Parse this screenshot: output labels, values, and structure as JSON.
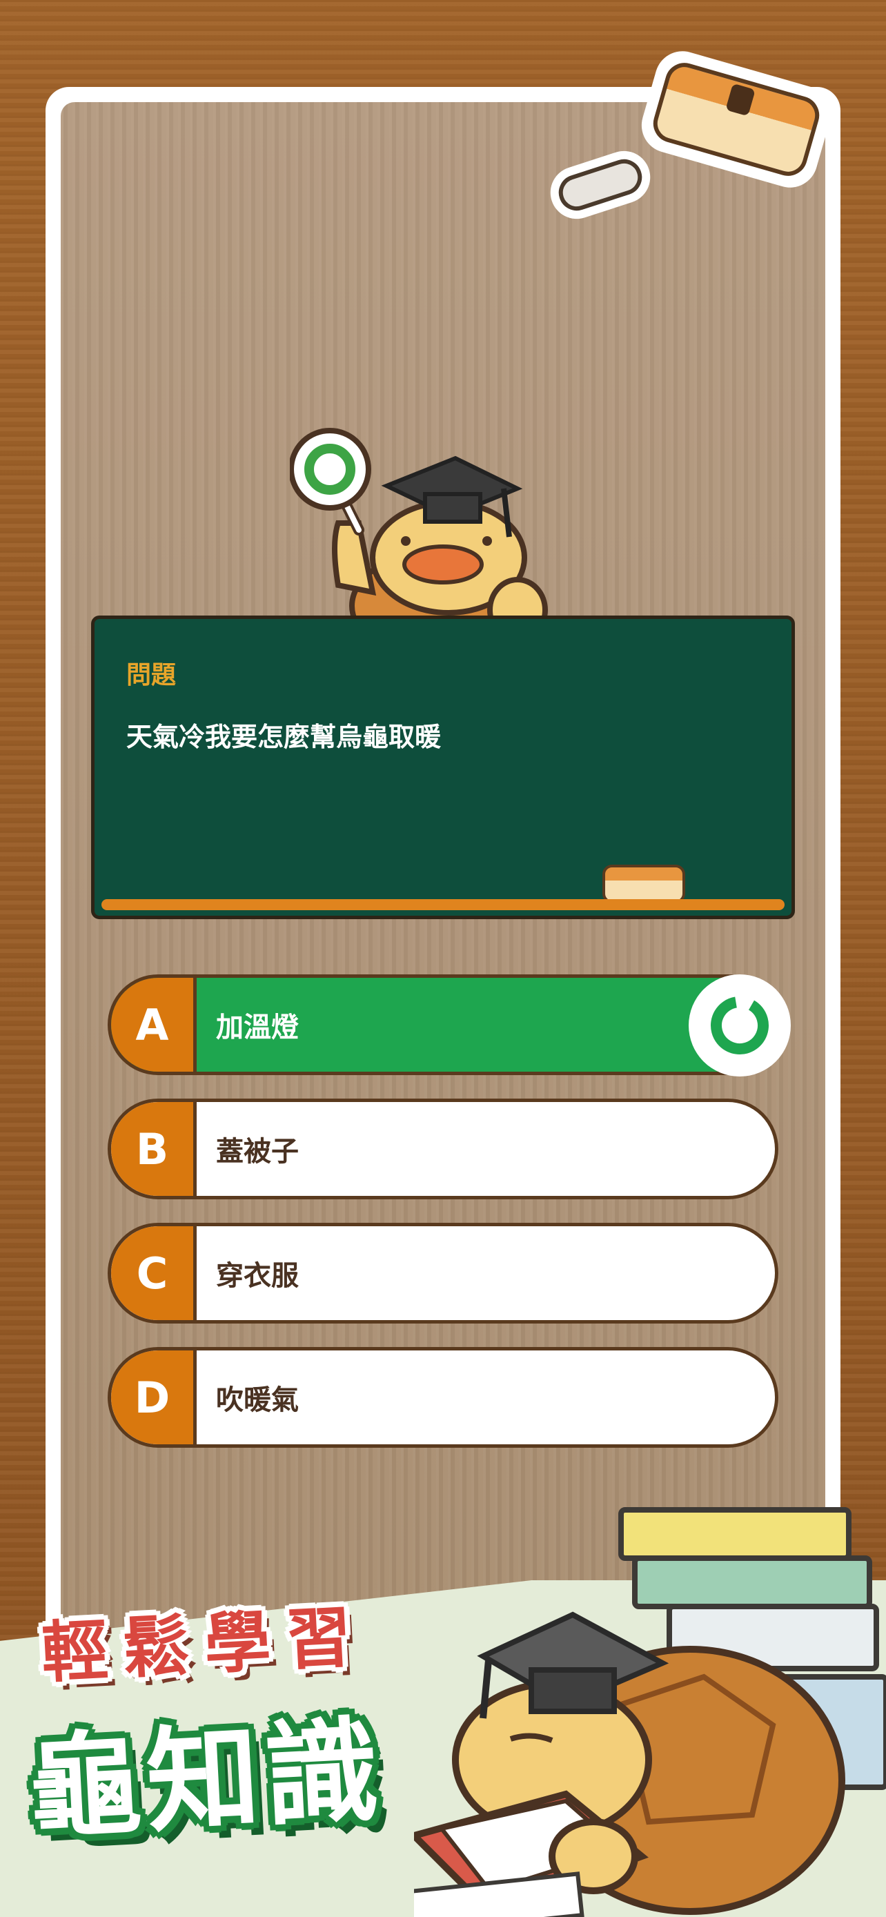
{
  "question": {
    "label": "問題",
    "text": "天氣冷我要怎麼幫烏龜取暖"
  },
  "options": [
    {
      "letter": "A",
      "text": "加溫燈",
      "state": "correct"
    },
    {
      "letter": "B",
      "text": "蓋被子",
      "state": "unanswered"
    },
    {
      "letter": "C",
      "text": "穿衣服",
      "state": "unanswered"
    },
    {
      "letter": "D",
      "text": "吹暖氣",
      "state": "unanswered"
    }
  ],
  "promo": {
    "line1": "輕鬆學習",
    "line2": "龜知識"
  },
  "colors": {
    "chalkboard": "#0e4e3c",
    "accent_orange": "#d9780e",
    "correct_green": "#1ea64f",
    "question_label": "#e8a52a"
  },
  "icons": {
    "correct_mark": "circle-o-icon",
    "mascot": "turtle-graduate-icon"
  }
}
